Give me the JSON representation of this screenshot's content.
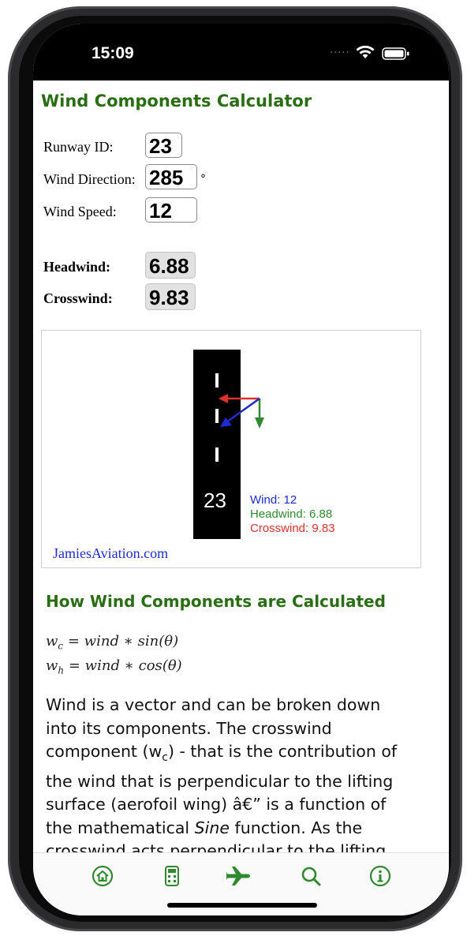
{
  "status": {
    "time": "15:09",
    "dots": "....."
  },
  "app": {
    "title": "Wind Components Calculator"
  },
  "form": {
    "runway_label": "Runway ID:",
    "runway_value": "23",
    "direction_label": "Wind Direction:",
    "direction_value": "285",
    "degree_symbol": "°",
    "speed_label": "Wind Speed:",
    "speed_value": "12"
  },
  "results": {
    "headwind_label": "Headwind:",
    "headwind_value": "6.88",
    "crosswind_label": "Crosswind:",
    "crosswind_value": "9.83"
  },
  "diagram": {
    "runway_number": "23",
    "wind_text": "Wind: 12",
    "headwind_text": "Headwind: 6.88",
    "crosswind_text": "Crosswind: 9.83",
    "site": "JamiesAviation.com",
    "colors": {
      "wind": "#1f2bd0",
      "headwind": "#2f8a2f",
      "crosswind": "#e0302c"
    }
  },
  "article": {
    "title": "How Wind Components are Calculated",
    "formula1": {
      "sym": "w",
      "sub": "c",
      "rest": " = wind ∗ sin(θ)"
    },
    "formula2": {
      "sym": "w",
      "sub": "h",
      "rest": " = wind ∗ cos(θ)"
    },
    "p_line1": "Wind is a vector and can be broken down",
    "p_line2": "into its components. The crosswind",
    "p_line3_a": "component (w",
    "p_line3_sub": "c",
    "p_line3_b": ") - that is the contribution of",
    "p_line4": "the wind that is perpendicular to the lifting",
    "p_line5": "surface (aerofoil wing) â€” is a function of",
    "p_line6_a": "the mathematical ",
    "p_line6_em": "Sine",
    "p_line6_b": " function. As the",
    "p_line7": "crosswind acts perpendicular to the lifting"
  },
  "tabbar": {
    "accent": "#2f8a2f",
    "icons": [
      "home-icon",
      "calculator-icon",
      "airplane-icon",
      "search-icon",
      "info-icon"
    ]
  }
}
